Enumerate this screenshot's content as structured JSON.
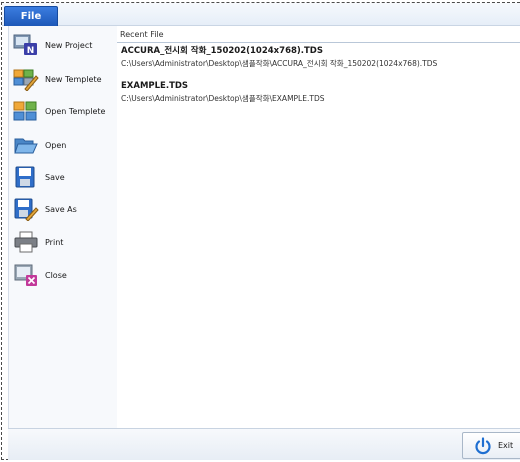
{
  "titlebar": {
    "file_tab": "File"
  },
  "sidebar": {
    "items": [
      {
        "label": "New Project",
        "icon": "new-project-icon"
      },
      {
        "label": "New Templete",
        "icon": "new-template-icon"
      },
      {
        "label": "Open Templete",
        "icon": "open-template-icon"
      },
      {
        "label": "Open",
        "icon": "folder-open-icon"
      },
      {
        "label": "Save",
        "icon": "save-icon"
      },
      {
        "label": "Save As",
        "icon": "save-as-icon"
      },
      {
        "label": "Print",
        "icon": "printer-icon"
      },
      {
        "label": "Close",
        "icon": "close-document-icon"
      }
    ]
  },
  "recent": {
    "header": "Recent File",
    "files": [
      {
        "name": "ACCURA_전시회 작화_150202(1024x768).TDS",
        "path": "C:\\Users\\Administrator\\Desktop\\샘플작화\\ACCURA_전시회 작화_150202(1024x768).TDS"
      },
      {
        "name": "EXAMPLE.TDS",
        "path": "C:\\Users\\Administrator\\Desktop\\샘플작화\\EXAMPLE.TDS"
      }
    ]
  },
  "footer": {
    "exit_label": "Exit",
    "exit_icon": "power-icon"
  },
  "colors": {
    "accent": "#1d58b8",
    "panel": "#f7f9fc",
    "border": "#c8d3e1"
  }
}
